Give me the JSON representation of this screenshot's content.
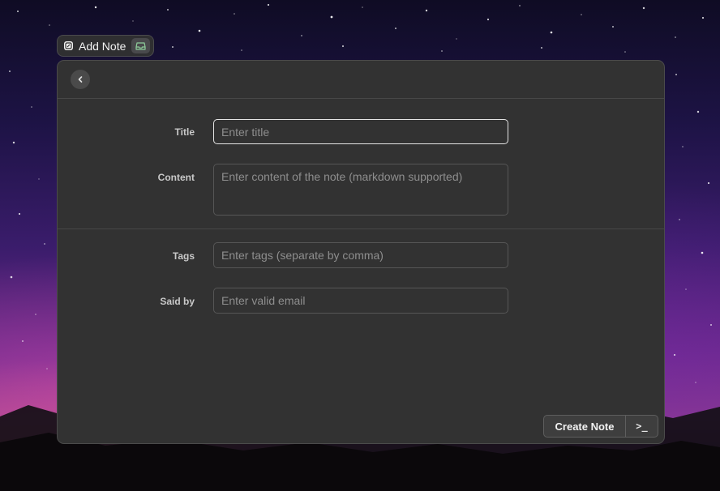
{
  "extension": {
    "title": "Add Note",
    "icon": "note-icon",
    "action_icon": "inbox-tray-icon",
    "action_icon_color": "#8fce9b"
  },
  "form": {
    "fields": [
      {
        "label": "Title",
        "placeholder": "Enter title",
        "value": ""
      },
      {
        "label": "Content",
        "placeholder": "Enter content of the note (markdown supported)",
        "value": ""
      },
      {
        "label": "Tags",
        "placeholder": "Enter tags (separate by comma)",
        "value": ""
      },
      {
        "label": "Said by",
        "placeholder": "Enter valid email",
        "value": ""
      }
    ]
  },
  "footer": {
    "primary_action": "Create Note",
    "shortcut": ">_"
  },
  "colors": {
    "window_bg": "#323232",
    "focus_border": "#e4e4e4"
  }
}
